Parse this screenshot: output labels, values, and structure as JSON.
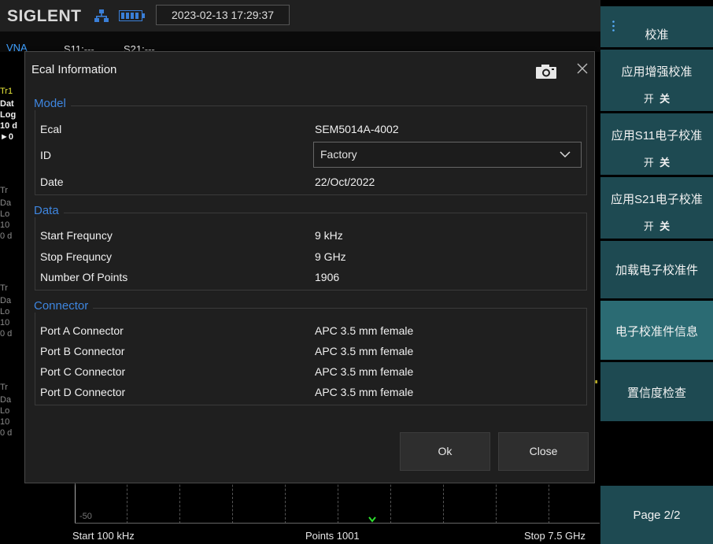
{
  "status_bar": {
    "brand": "SIGLENT",
    "datetime": "2023-02-13 17:29:37"
  },
  "trace_header": {
    "mode": "VNA",
    "s11": "S11:---",
    "s21": "S21:---"
  },
  "background_trace_fragments": {
    "tr1": "Tr1",
    "dat1": "Dat",
    "log1": "Log",
    "scale1": "10 d",
    "ref1": "►0",
    "tr2": "Tr",
    "dat2": "Da",
    "log2": "Lo",
    "scale2": "10",
    "ref2": "0 d",
    "tr3": "Tr",
    "dat3": "Da",
    "log3": "Lo",
    "scale3": "10",
    "ref3": "0 d",
    "tr4": "Tr",
    "dat4": "Da",
    "log4": "Lo",
    "scale4": "10",
    "ref4": "0 d"
  },
  "plot": {
    "y_tick": "-50",
    "start": "Start  100 kHz",
    "points": "Points  1001",
    "stop": "Stop  7.5 GHz"
  },
  "menu": {
    "title": "校准",
    "apply_enhanced": {
      "label": "应用增强校准",
      "on": "开",
      "off": "关"
    },
    "apply_s11": {
      "label": "应用S11电子校准",
      "on": "开",
      "off": "关"
    },
    "apply_s21": {
      "label": "应用S21电子校准",
      "on": "开",
      "off": "关"
    },
    "load_ecal": "加载电子校准件",
    "ecal_info": "电子校准件信息",
    "confidence_check": "置信度检查",
    "page": "Page 2/2"
  },
  "dialog": {
    "title": "Ecal Information",
    "model_group": {
      "title": "Model",
      "ecal_label": "Ecal",
      "ecal_value": "SEM5014A-4002",
      "id_label": "ID",
      "id_value": "Factory",
      "date_label": "Date",
      "date_value": "22/Oct/2022"
    },
    "data_group": {
      "title": "Data",
      "start_label": "Start Frequncy",
      "start_value": "9 kHz",
      "stop_label": "Stop Frequncy",
      "stop_value": "9 GHz",
      "points_label": "Number Of Points",
      "points_value": "1906"
    },
    "connector_group": {
      "title": "Connector",
      "rows": [
        {
          "label": "Port A Connector",
          "value": "APC 3.5 mm female"
        },
        {
          "label": "Port B Connector",
          "value": "APC 3.5 mm female"
        },
        {
          "label": "Port C Connector",
          "value": "APC 3.5 mm female"
        },
        {
          "label": "Port D Connector",
          "value": "APC 3.5 mm female"
        }
      ]
    },
    "ok_label": "Ok",
    "close_label": "Close"
  },
  "colors": {
    "menu_key": "#1e4a52",
    "menu_key_selected": "#2b6b73",
    "group_title": "#3e86e0",
    "trace_header": "#3fa0ff"
  }
}
